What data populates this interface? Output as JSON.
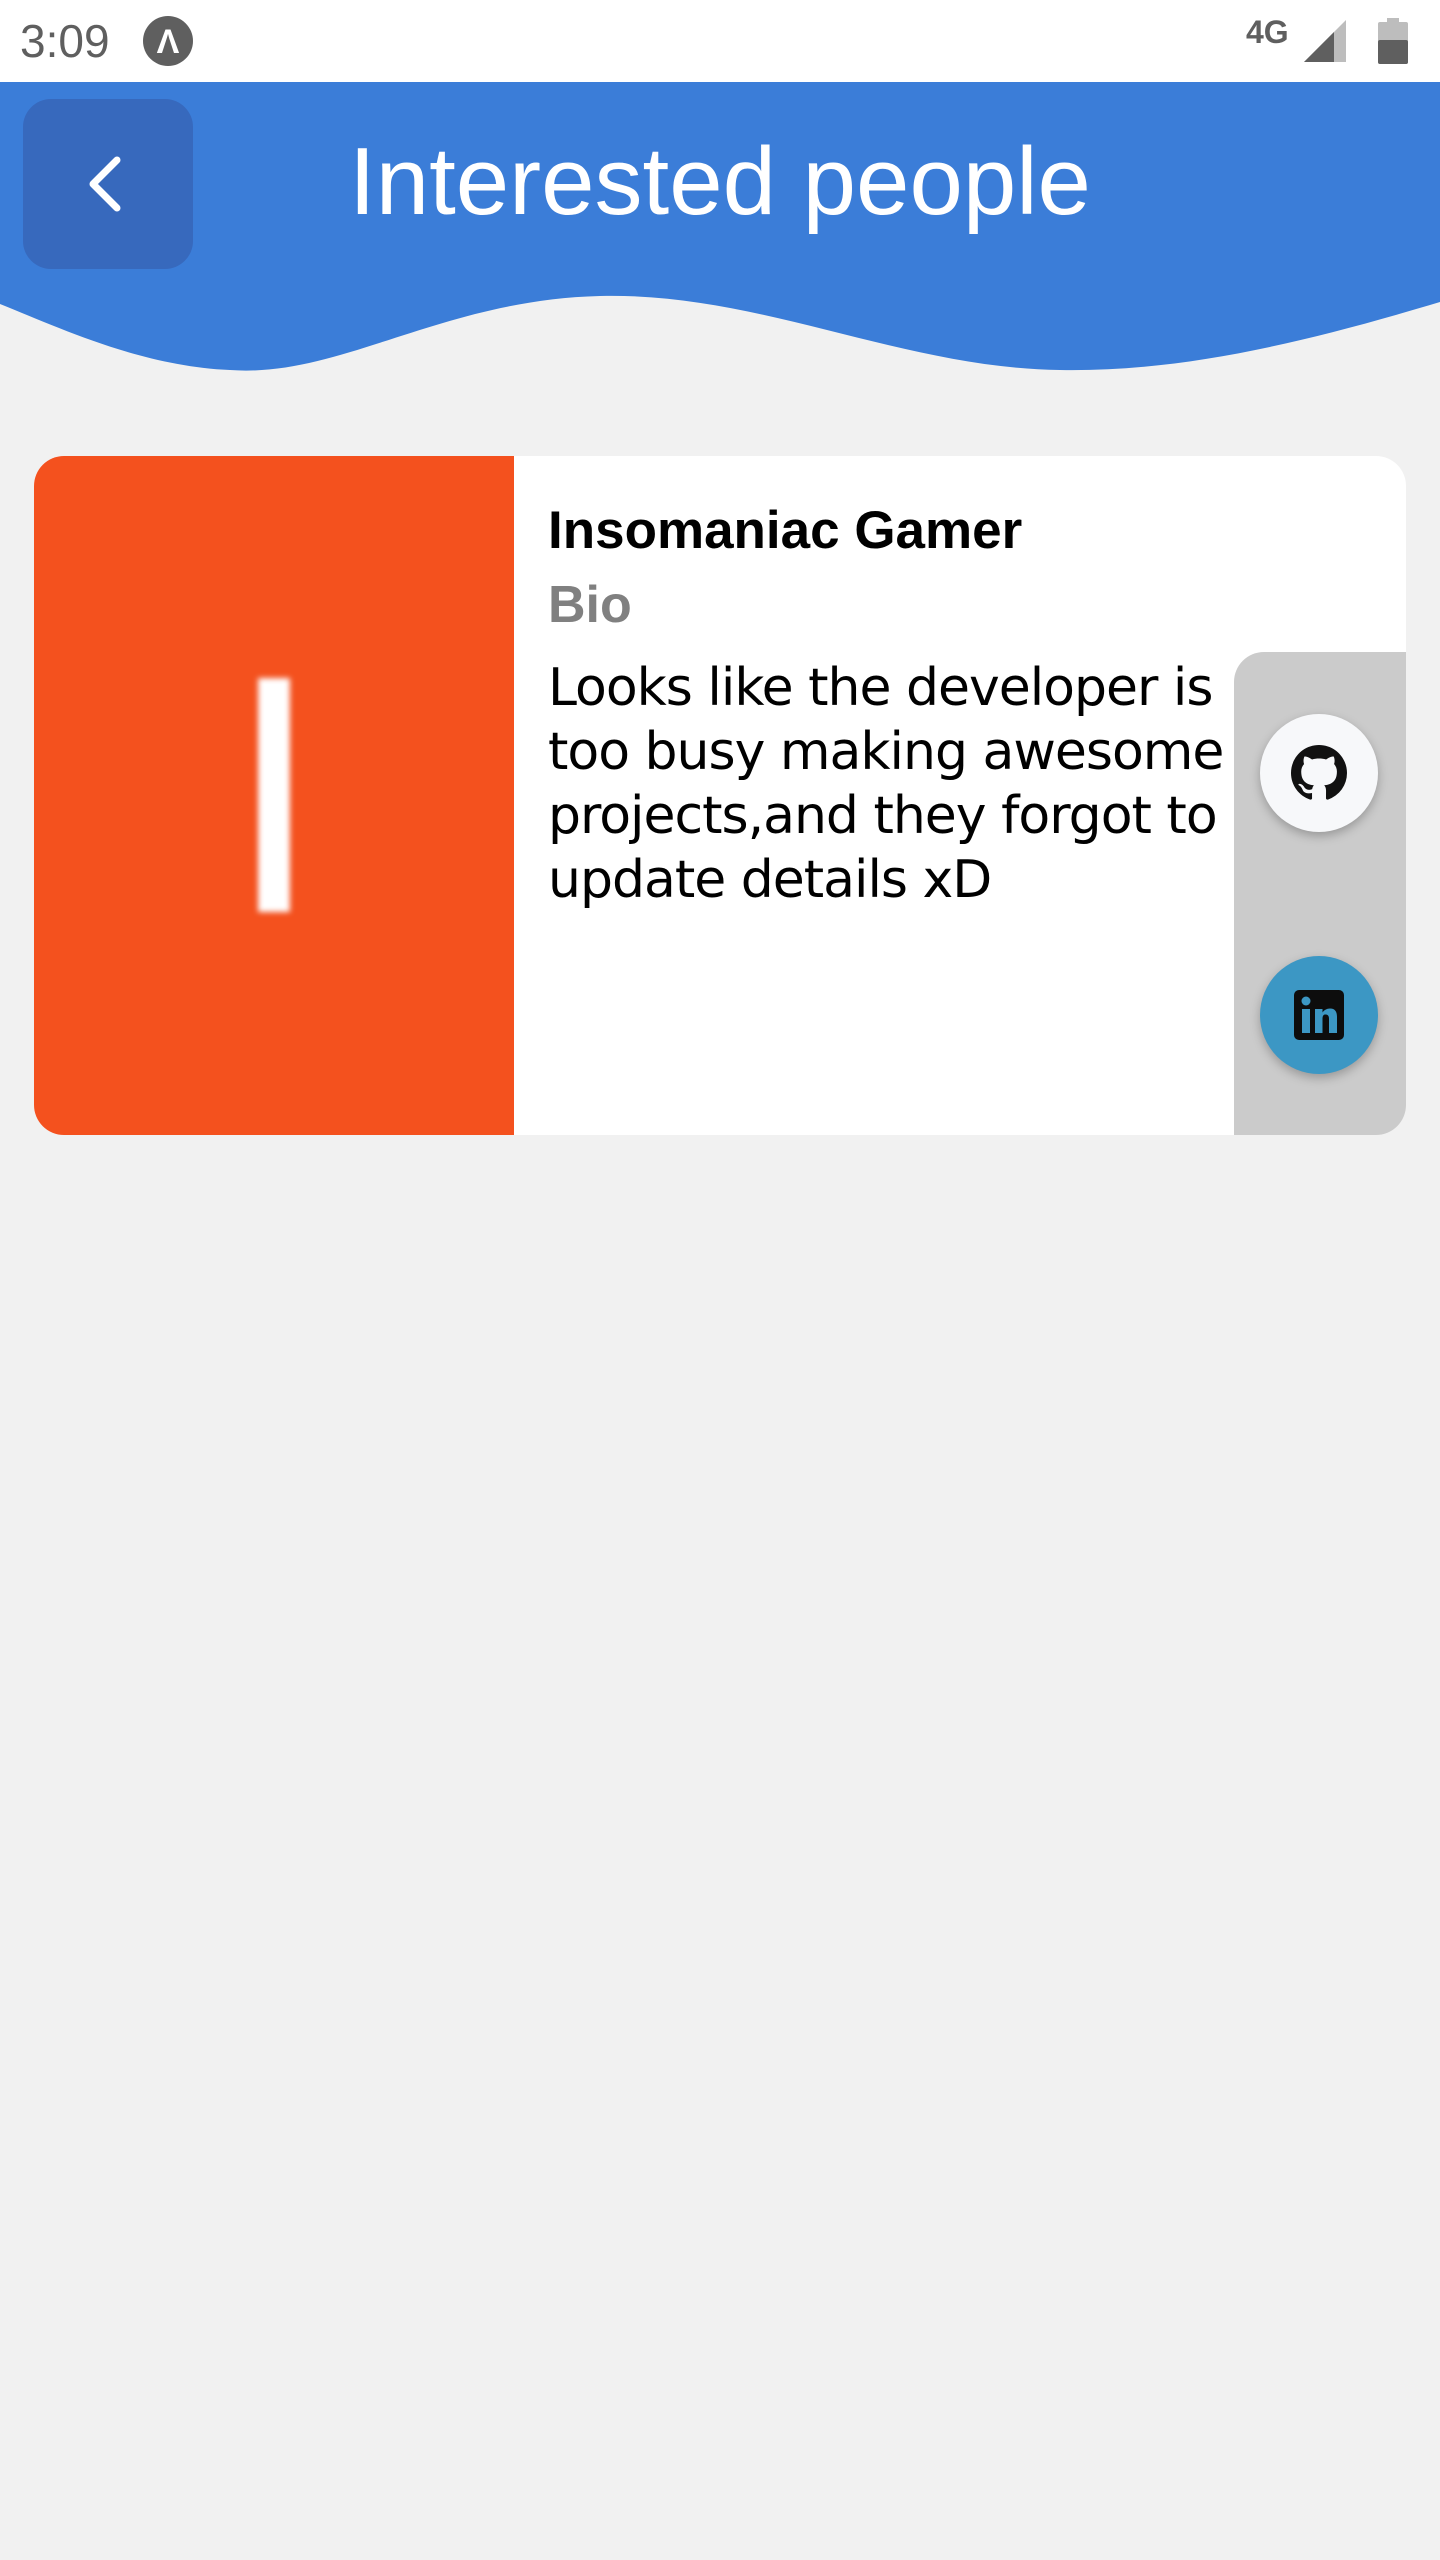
{
  "status_bar": {
    "time": "3:09",
    "app_icon_glyph": "Λ",
    "network": "4G",
    "icons": [
      "app-notification-icon",
      "signal-icon",
      "battery-icon"
    ]
  },
  "header": {
    "title": "Interested people",
    "back_icon": "chevron-left-icon",
    "colors": {
      "background": "#3b7dd8",
      "back_button": "#3769bd"
    }
  },
  "people": [
    {
      "avatar_letter": "I",
      "avatar_color": "#f4511e",
      "name": "Insomaniac Gamer",
      "bio_label": "Bio",
      "bio": "Looks like the developer is too busy making awesome projects,and they forgot to update details xD",
      "social": [
        {
          "icon": "github-icon",
          "color": "#f7f8fa"
        },
        {
          "icon": "linkedin-icon",
          "color": "#3c97c4"
        }
      ]
    }
  ]
}
